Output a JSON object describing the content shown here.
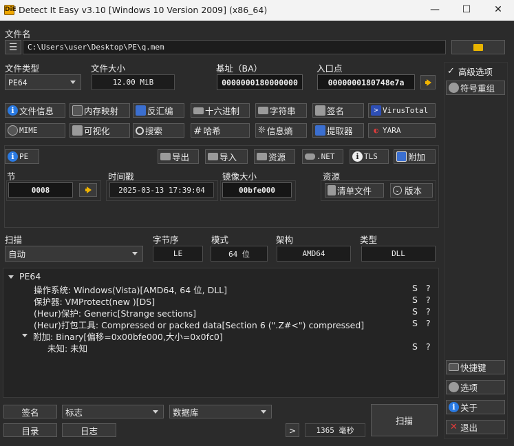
{
  "window": {
    "title": "Detect It Easy v3.10 [Windows 10 Version 2009] (x86_64)",
    "app_icon_text": "DiE",
    "minimize": "—",
    "maximize": "☐",
    "close": "✕"
  },
  "file": {
    "label": "文件名",
    "path": "C:\\Users\\user\\Desktop\\PE\\q.mem"
  },
  "info": {
    "type_label": "文件类型",
    "type_value": "PE64",
    "size_label": "文件大小",
    "size_value": "12.00 MiB",
    "base_label": "基址（BA）",
    "base_value": "0000000180000000",
    "entry_label": "入口点",
    "entry_value": "0000000180748e7a"
  },
  "right_panel": {
    "advanced_check": "✓",
    "advanced_label": "高级选项",
    "symbol_rebuild": "符号重组",
    "shortcuts": "快捷键",
    "options": "选项",
    "about": "关于",
    "exit": "退出"
  },
  "tools_row1": [
    "文件信息",
    "内存映射",
    "反汇编",
    "十六进制",
    "字符串",
    "签名",
    "VirusTotal"
  ],
  "tools_row2": [
    "MIME",
    "可视化",
    "搜索",
    "哈希",
    "信息熵",
    "提取器",
    "YARA"
  ],
  "pe_row": {
    "pe": "PE",
    "export": "导出",
    "import": "导入",
    "resources": "资源",
    "net": ".NET",
    "tls": "TLS",
    "overlay": "附加"
  },
  "pe_info": {
    "section_label": "节",
    "section_value": "0008",
    "timestamp_label": "时间戳",
    "timestamp_value": "2025-03-13 17:39:04",
    "image_size_label": "镜像大小",
    "image_size_value": "00bfe000",
    "resources_label": "资源",
    "manifest_btn": "清单文件",
    "version_btn": "版本"
  },
  "scan": {
    "scan_label": "扫描",
    "scan_value": "自动",
    "endian_label": "字节序",
    "endian_value": "LE",
    "mode_label": "模式",
    "mode_value": "64 位",
    "arch_label": "架构",
    "arch_value": "AMD64",
    "type_label": "类型",
    "type_value": "DLL"
  },
  "results": [
    {
      "text": "PE64",
      "indent": 0,
      "expand": true,
      "s": "",
      "q": ""
    },
    {
      "text": "操作系统: Windows(Vista)[AMD64, 64 位, DLL]",
      "indent": 1,
      "expand": false,
      "s": "S",
      "q": "?"
    },
    {
      "text": "保护器: VMProtect(new )[DS]",
      "indent": 1,
      "expand": false,
      "s": "S",
      "q": "?"
    },
    {
      "text": "(Heur)保护: Generic[Strange sections]",
      "indent": 1,
      "expand": false,
      "s": "S",
      "q": "?"
    },
    {
      "text": "(Heur)打包工具: Compressed or packed data[Section 6 (\".Z#<\") compressed]",
      "indent": 1,
      "expand": false,
      "s": "S",
      "q": "?"
    },
    {
      "text": "附加: Binary[偏移=0x00bfe000,大小=0x0fc0]",
      "indent": 1,
      "expand": true,
      "s": "",
      "q": ""
    },
    {
      "text": "未知: 未知",
      "indent": 2,
      "expand": false,
      "s": "S",
      "q": "?"
    }
  ],
  "bottom": {
    "signature": "签名",
    "flags": "标志",
    "database": "数据库",
    "scan": "扫描",
    "directory": "目录",
    "log": "日志",
    "next": ">",
    "time": "1365 毫秒"
  }
}
